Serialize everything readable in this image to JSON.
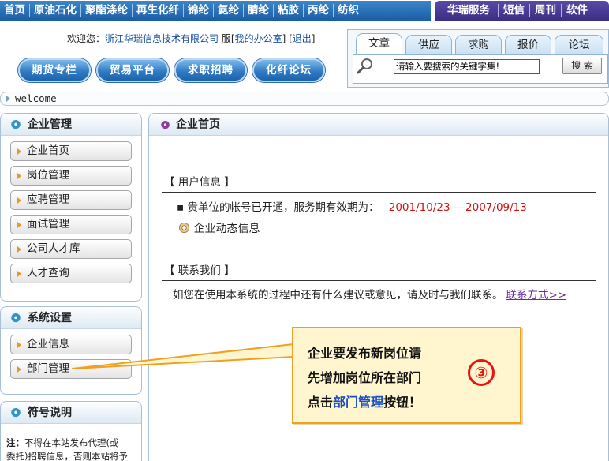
{
  "top_nav": {
    "main_items": [
      "首页",
      "原油石化",
      "聚酯涤纶",
      "再生化纤",
      "锦纶",
      "氨纶",
      "腈纶",
      "粘胶",
      "丙纶",
      "纺织"
    ],
    "service_items": [
      "华瑞服务",
      "短信",
      "周刊",
      "软件"
    ]
  },
  "user_bar": {
    "greeting": "欢迎您：",
    "company": "浙江华瑞信息技术有限公司",
    "trailing_char": "服",
    "office_link": "我的办公室",
    "logout_link": "退出",
    "bracket_open": "[",
    "bracket_close": "]"
  },
  "quick_buttons": [
    "期货专栏",
    "贸易平台",
    "求职招聘",
    "化纤论坛"
  ],
  "search": {
    "tabs": [
      "文章",
      "供应",
      "求购",
      "报价",
      "论坛"
    ],
    "active_tab": "文章",
    "input_value": "请输入要搜索的关键字集!",
    "button_label": "搜 索"
  },
  "breadcrumb": "welcome",
  "sidebar": {
    "enterprise": {
      "title": "企业管理",
      "items": [
        "企业首页",
        "岗位管理",
        "应聘管理",
        "面试管理",
        "公司人才库",
        "人才查询"
      ]
    },
    "system": {
      "title": "系统设置",
      "items": [
        "企业信息",
        "部门管理"
      ]
    },
    "legend": {
      "title": "符号说明",
      "note_prefix": "注：",
      "note_line1": "不得在本站发布代理(或",
      "note_line2": "委托)招聘信息，否则本站将予"
    }
  },
  "main": {
    "title": "企业首页",
    "user_info": {
      "heading": "【 用户信息 】",
      "bullet": "▪",
      "account_text": "贵单位的帐号已开通，服务期有效期为：",
      "validity": "2001/10/23----2007/09/13",
      "dynamic_link": "企业动态信息"
    },
    "contact": {
      "heading": "【 联系我们 】",
      "text": "如您在使用本系统的过程中还有什么建议或意见，请及时与我们联系。",
      "link": "联系方式>>"
    }
  },
  "callout": {
    "line1": "企业要发布新岗位请",
    "line2": "先增加岗位所在部门",
    "line3_prefix": "点击",
    "line3_highlight": "部门管理",
    "line3_suffix": "按钮！",
    "step_number": "③"
  },
  "colors": {
    "nav_blue": "#1b5da6",
    "nav_purple": "#3b2d85",
    "validity_red": "#d11111",
    "link_blue": "#1a4fa0",
    "callout_border": "#f0a020",
    "callout_bg": "#fff6cf",
    "step_red": "#e11111"
  }
}
